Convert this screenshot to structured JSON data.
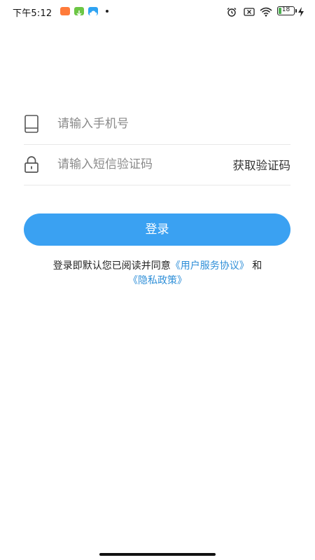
{
  "status_bar": {
    "time": "下午5:12",
    "battery_level": "18",
    "notification_icons": [
      "app-notification-icon",
      "download-icon",
      "cloud-icon"
    ],
    "system_icons": [
      "alarm-icon",
      "no-sim-icon",
      "wifi-icon",
      "battery-icon",
      "charging-icon"
    ]
  },
  "form": {
    "phone_placeholder": "请输入手机号",
    "phone_icon": "phone-icon",
    "code_placeholder": "请输入短信验证码",
    "code_icon": "lock-icon",
    "get_code_label": "获取验证码"
  },
  "login_button": {
    "label": "登录"
  },
  "agreement": {
    "prefix": "登录即默认您已阅读并同意",
    "service_link": "《用户服务协议》",
    "conjunction": "和",
    "privacy_link": "《隐私政策》"
  },
  "colors": {
    "accent": "#3aa1f2",
    "link": "#2f8fd8",
    "divider": "#e8e8e8",
    "placeholder": "#8a8a8a"
  }
}
